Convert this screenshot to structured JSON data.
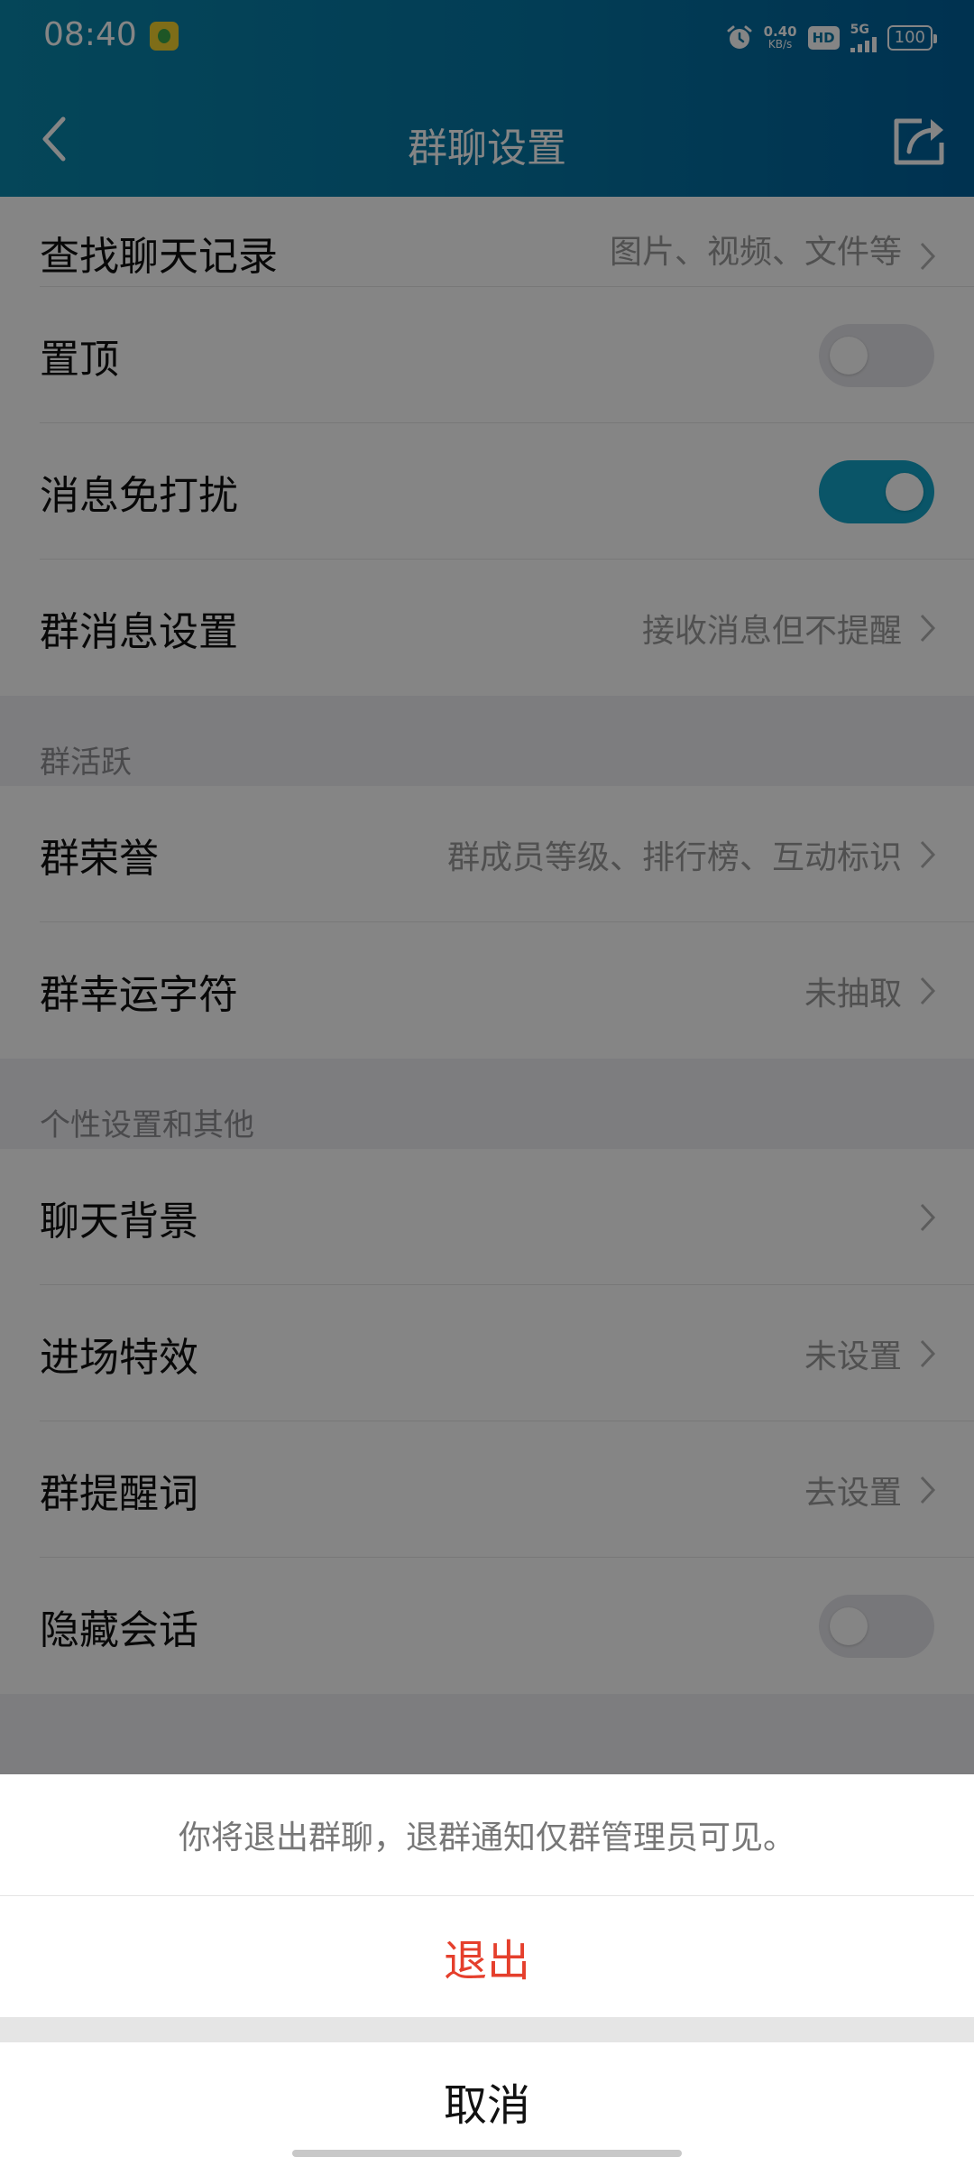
{
  "status_bar": {
    "time": "08:40",
    "net_speed_value": "0.40",
    "net_speed_unit": "KB/s",
    "hd": "HD",
    "network": "5G",
    "battery": "100"
  },
  "nav": {
    "title": "群聊设置",
    "back_icon": "chevron-left-icon",
    "share_icon": "share-icon"
  },
  "colors": {
    "header_start": "#0a86ab",
    "header_end": "#00609a",
    "toggle_on": "#14a3c7",
    "exit_red": "#e53f2c"
  },
  "settings": {
    "search_history": {
      "label": "查找聊天记录",
      "value": "图片、视频、文件等"
    },
    "pin_top": {
      "label": "置顶",
      "on": false
    },
    "do_not_disturb": {
      "label": "消息免打扰",
      "on": true
    },
    "group_message": {
      "label": "群消息设置",
      "value": "接收消息但不提醒"
    },
    "section_activity": "群活跃",
    "group_honor": {
      "label": "群荣誉",
      "value": "群成员等级、排行榜、互动标识"
    },
    "lucky_char": {
      "label": "群幸运字符",
      "value": "未抽取"
    },
    "section_personal": "个性设置和其他",
    "chat_background": {
      "label": "聊天背景",
      "value": ""
    },
    "entry_effect": {
      "label": "进场特效",
      "value": "未设置"
    },
    "group_reminder": {
      "label": "群提醒词",
      "value": "去设置"
    },
    "hide_session": {
      "label": "隐藏会话",
      "on": false
    }
  },
  "action_sheet": {
    "message": "你将退出群聊，退群通知仅群管理员可见。",
    "exit_label": "退出",
    "cancel_label": "取消"
  }
}
